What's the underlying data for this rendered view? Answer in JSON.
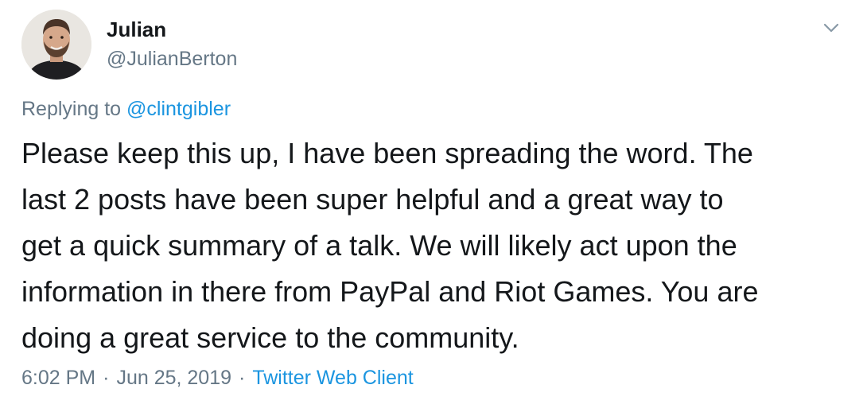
{
  "author": {
    "display_name": "Julian",
    "handle": "@JulianBerton"
  },
  "menu": {
    "icon": "chevron-down-icon"
  },
  "reply": {
    "prefix": "Replying to",
    "mention": "@clintgibler"
  },
  "body": {
    "lines": [
      "Please keep this up, I have been spreading the word. The",
      "last 2 posts have been super helpful and a great way to",
      "get a quick summary of a talk. We will likely act upon the",
      "information in there from PayPal and Riot Games. You are",
      "doing a great service to the community."
    ]
  },
  "meta": {
    "time": "6:02 PM",
    "separator": "·",
    "date": "Jun 25, 2019",
    "client": "Twitter Web Client"
  },
  "colors": {
    "text": "#14171a",
    "secondary": "#657786",
    "link": "#1b95e0"
  }
}
